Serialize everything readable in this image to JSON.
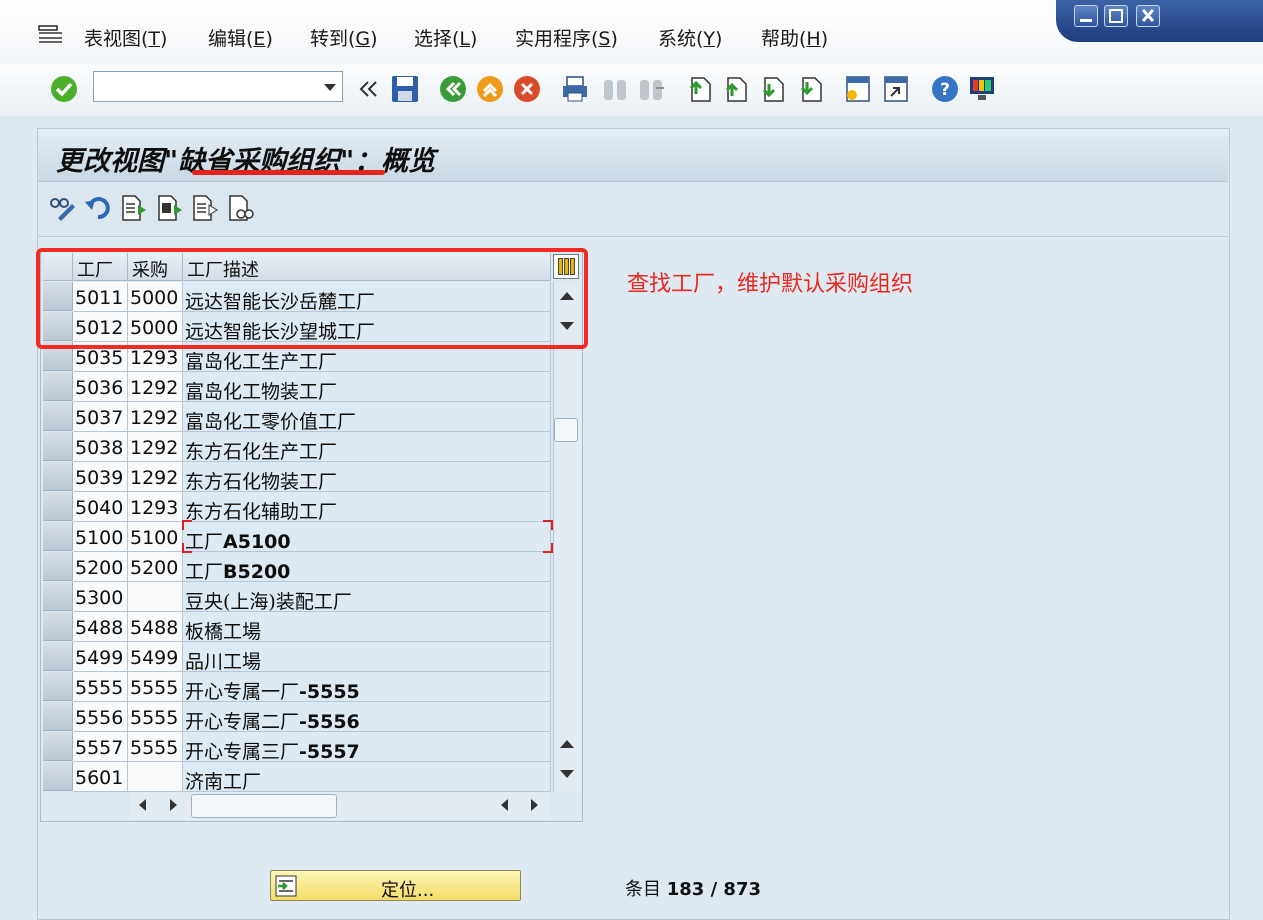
{
  "menu": {
    "items": [
      {
        "label": "表视图(",
        "key": "T",
        "suffix": ")"
      },
      {
        "label": "编辑(",
        "key": "E",
        "suffix": ")"
      },
      {
        "label": "转到(",
        "key": "G",
        "suffix": ")"
      },
      {
        "label": "选择(",
        "key": "L",
        "suffix": ")"
      },
      {
        "label": "实用程序(",
        "key": "S",
        "suffix": ")"
      },
      {
        "label": "系统(",
        "key": "Y",
        "suffix": ")"
      },
      {
        "label": "帮助(",
        "key": "H",
        "suffix": ")"
      }
    ]
  },
  "toolbar": {
    "command_value": "",
    "colors": {
      "enter": "#4caf2a",
      "back": "#3a9b3a",
      "exit": "#f09a1c",
      "cancel": "#d94a2a"
    }
  },
  "page": {
    "title": "更改视图\"缺省采购组织\"：概览"
  },
  "table": {
    "headers": [
      "工厂",
      "采购",
      "工厂描述"
    ],
    "rows": [
      {
        "plant": "5011",
        "porg": "5000",
        "desc": "远达智能长沙岳麓工厂",
        "bold": ""
      },
      {
        "plant": "5012",
        "porg": "5000",
        "desc": "远达智能长沙望城工厂",
        "bold": ""
      },
      {
        "plant": "5035",
        "porg": "1293",
        "desc": "富岛化工生产工厂",
        "bold": ""
      },
      {
        "plant": "5036",
        "porg": "1292",
        "desc": "富岛化工物装工厂",
        "bold": ""
      },
      {
        "plant": "5037",
        "porg": "1292",
        "desc": "富岛化工零价值工厂",
        "bold": ""
      },
      {
        "plant": "5038",
        "porg": "1292",
        "desc": "东方石化生产工厂",
        "bold": ""
      },
      {
        "plant": "5039",
        "porg": "1292",
        "desc": "东方石化物装工厂",
        "bold": ""
      },
      {
        "plant": "5040",
        "porg": "1293",
        "desc": "东方石化辅助工厂",
        "bold": ""
      },
      {
        "plant": "5100",
        "porg": "5100",
        "desc": "工厂",
        "bold": "A5100"
      },
      {
        "plant": "5200",
        "porg": "5200",
        "desc": "工厂",
        "bold": "B5200"
      },
      {
        "plant": "5300",
        "porg": "",
        "desc": "豆央(上海)装配工厂",
        "bold": ""
      },
      {
        "plant": "5488",
        "porg": "5488",
        "desc": "板橋工場",
        "bold": ""
      },
      {
        "plant": "5499",
        "porg": "5499",
        "desc": "品川工場",
        "bold": ""
      },
      {
        "plant": "5555",
        "porg": "5555",
        "desc": "开心专属一厂",
        "bold": "-5555"
      },
      {
        "plant": "5556",
        "porg": "5555",
        "desc": "开心专属二厂",
        "bold": "-5556"
      },
      {
        "plant": "5557",
        "porg": "5555",
        "desc": "开心专属三厂",
        "bold": "-5557"
      },
      {
        "plant": "5601",
        "porg": "",
        "desc": "济南工厂",
        "bold": ""
      }
    ]
  },
  "annotation": {
    "text": "查找工厂，维护默认采购组织",
    "color": "#e9291f"
  },
  "footer": {
    "locate_label": "定位...",
    "entries_label": "条目",
    "entries_value": "183 / 873"
  }
}
